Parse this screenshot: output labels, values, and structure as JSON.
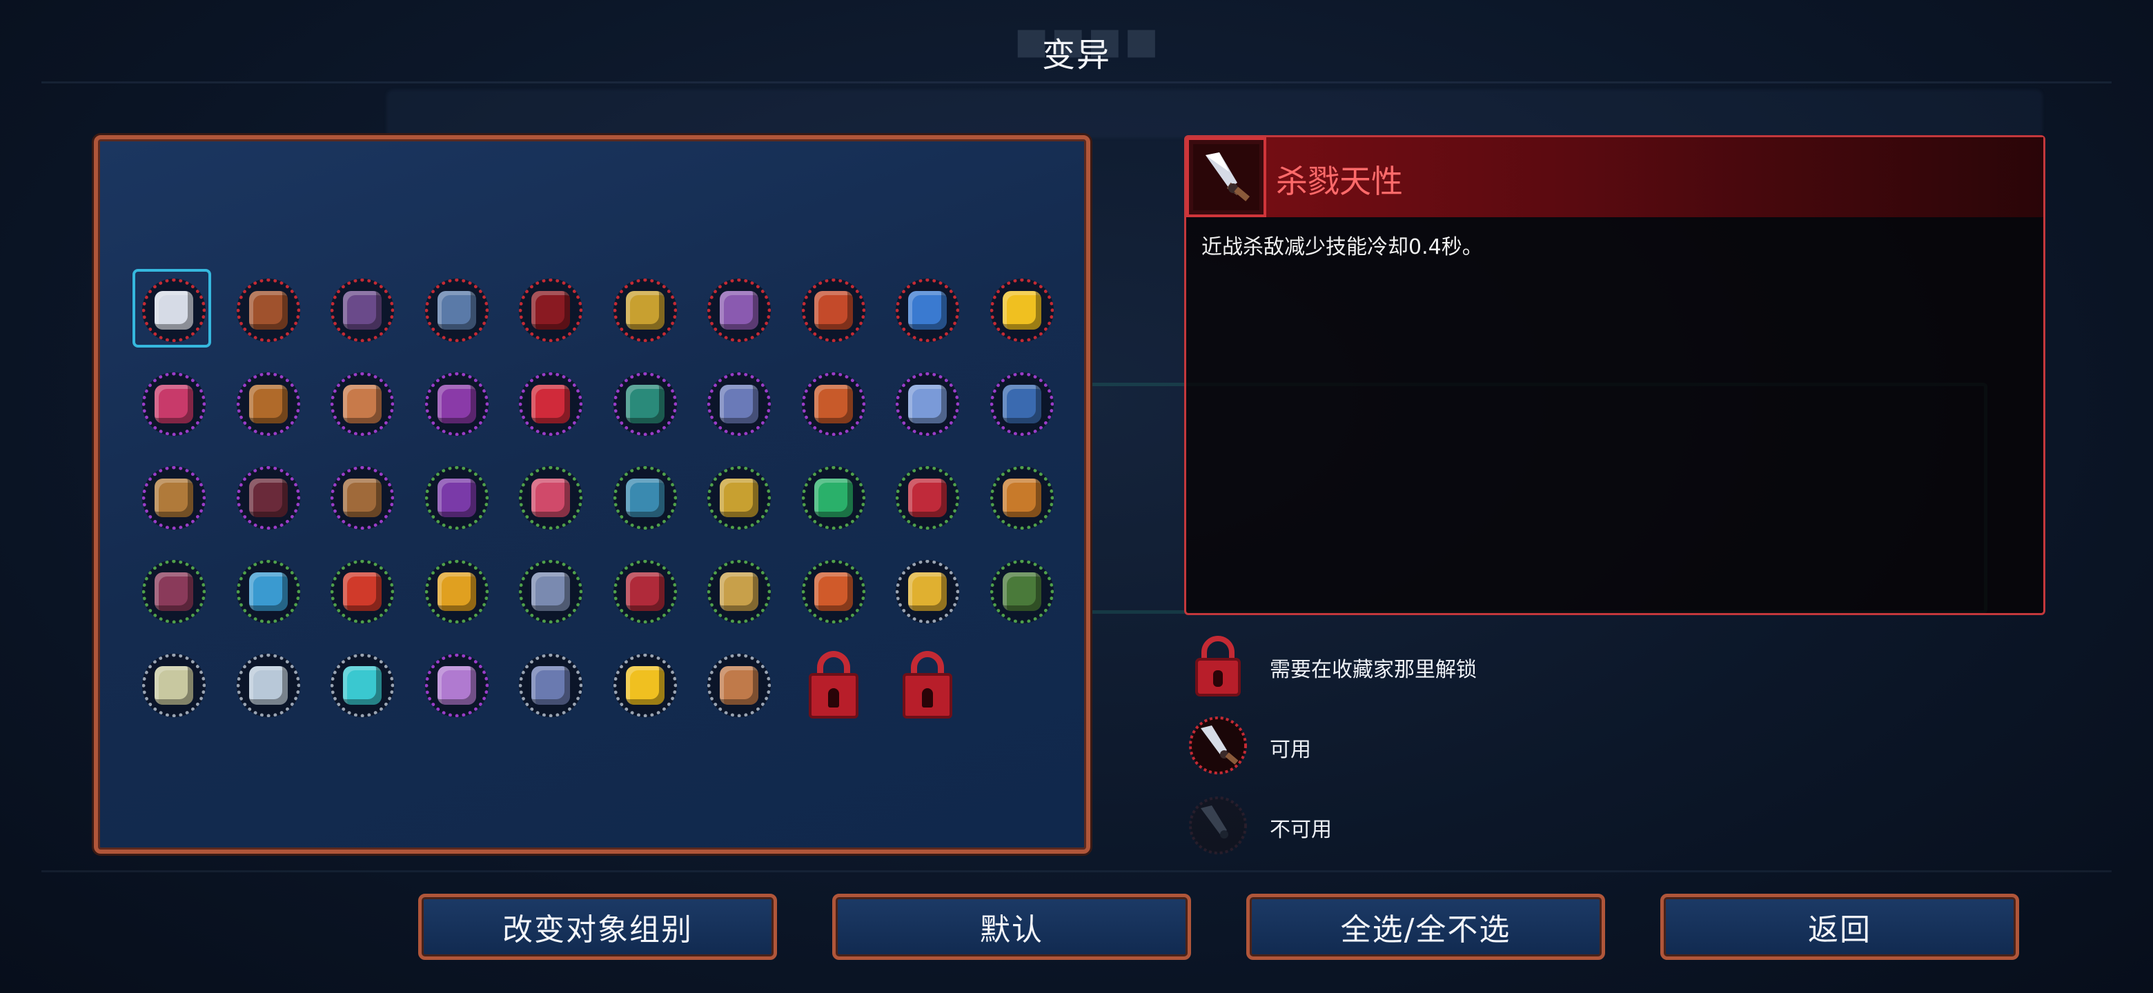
{
  "header": {
    "title": "变异"
  },
  "info": {
    "name": "杀戮天性",
    "description": "近战杀敌减少技能冷却0.4秒。",
    "icon": "dagger-icon"
  },
  "legend": [
    {
      "text": "需要在收藏家那里解锁",
      "icon": "lock-icon"
    },
    {
      "text": "可用",
      "icon": "dagger-icon"
    },
    {
      "text": "不可用",
      "icon": "dagger-disabled-icon"
    }
  ],
  "buttons": {
    "change_group": "改变对象组别",
    "default": "默认",
    "select_all": "全选/全不选",
    "back": "返回"
  },
  "colors": {
    "brutality": "#c42a34",
    "tactics": "#9a3cc8",
    "survival": "#4fa04a",
    "colorless": "#9aa4b2",
    "selection": "#36b8de"
  },
  "mutations": [
    {
      "icon": "dagger-icon",
      "color": "#c42a34",
      "fill": "#d6dbe6",
      "selected": true
    },
    {
      "icon": "bow-icon",
      "color": "#c42a34",
      "fill": "#a0522d"
    },
    {
      "icon": "claw-icon",
      "color": "#c42a34",
      "fill": "#6a4a8a"
    },
    {
      "icon": "scythe-frost-icon",
      "color": "#c42a34",
      "fill": "#5a7aa8"
    },
    {
      "icon": "slash-icon",
      "color": "#c42a34",
      "fill": "#8a1a22"
    },
    {
      "icon": "potion-icon",
      "color": "#c42a34",
      "fill": "#c8a030"
    },
    {
      "icon": "blaster-icon",
      "color": "#c42a34",
      "fill": "#8a5ab0"
    },
    {
      "icon": "apple-icon",
      "color": "#c42a34",
      "fill": "#c44a2a"
    },
    {
      "icon": "ice-potion-icon",
      "color": "#c42a34",
      "fill": "#3a7ad0"
    },
    {
      "icon": "lightning-icon",
      "color": "#c42a34",
      "fill": "#f0c020"
    },
    {
      "icon": "crystal-icon",
      "color": "#9a3cc8",
      "fill": "#c83a6a"
    },
    {
      "icon": "fist-icon",
      "color": "#9a3cc8",
      "fill": "#b06a2a"
    },
    {
      "icon": "ring-icon",
      "color": "#9a3cc8",
      "fill": "#c87a4a"
    },
    {
      "icon": "bomb-icon",
      "color": "#9a3cc8",
      "fill": "#8a3aa8"
    },
    {
      "icon": "cross-icon",
      "color": "#9a3cc8",
      "fill": "#d02a3a"
    },
    {
      "icon": "flask-icon",
      "color": "#9a3cc8",
      "fill": "#2a8a7a"
    },
    {
      "icon": "turret-icon",
      "color": "#9a3cc8",
      "fill": "#6a7ab8"
    },
    {
      "icon": "no-entry-icon",
      "color": "#9a3cc8",
      "fill": "#c85a2a"
    },
    {
      "icon": "whip-icon",
      "color": "#9a3cc8",
      "fill": "#7a9ad8"
    },
    {
      "icon": "shard-icon",
      "color": "#9a3cc8",
      "fill": "#3a6ab0"
    },
    {
      "icon": "crossbow-frost-icon",
      "color": "#9a3cc8",
      "fill": "#b07a3a"
    },
    {
      "icon": "bow-dark-icon",
      "color": "#9a3cc8",
      "fill": "#6a2a3a"
    },
    {
      "icon": "gauntlet-icon",
      "color": "#9a3cc8",
      "fill": "#a06a3a"
    },
    {
      "icon": "drop-icon",
      "color": "#4fa04a",
      "fill": "#7a3aa8"
    },
    {
      "icon": "skull-swords-icon",
      "color": "#4fa04a",
      "fill": "#d04a6a"
    },
    {
      "icon": "shield-eye-icon",
      "color": "#4fa04a",
      "fill": "#3a8ab0"
    },
    {
      "icon": "shield-icon",
      "color": "#4fa04a",
      "fill": "#c8a030"
    },
    {
      "icon": "heart-shield-icon",
      "color": "#4fa04a",
      "fill": "#2ab06a"
    },
    {
      "icon": "fang-icon",
      "color": "#4fa04a",
      "fill": "#c02a3a"
    },
    {
      "icon": "torch-icon",
      "color": "#4fa04a",
      "fill": "#c87a2a"
    },
    {
      "icon": "horseshoe-icon",
      "color": "#4fa04a",
      "fill": "#8a3a5a"
    },
    {
      "icon": "grid-icon",
      "color": "#4fa04a",
      "fill": "#3a9ad0"
    },
    {
      "icon": "flame-icon",
      "color": "#4fa04a",
      "fill": "#d03a2a"
    },
    {
      "icon": "double-chevron-icon",
      "color": "#4fa04a",
      "fill": "#e0a020"
    },
    {
      "icon": "fist-shield-icon",
      "color": "#4fa04a",
      "fill": "#7a8ab0"
    },
    {
      "icon": "heart-icon",
      "color": "#4fa04a",
      "fill": "#b02a3a"
    },
    {
      "icon": "horn-icon",
      "color": "#4fa04a",
      "fill": "#c8a04a"
    },
    {
      "icon": "potion-heal-icon",
      "color": "#4fa04a",
      "fill": "#d05a2a"
    },
    {
      "icon": "chevron-right-icon",
      "color": "#9aa4b2",
      "fill": "#e0b030"
    },
    {
      "icon": "leaf-icon",
      "color": "#4fa04a",
      "fill": "#4a7a3a"
    },
    {
      "icon": "skull-green-icon",
      "color": "#9aa4b2",
      "fill": "#c8c8a0"
    },
    {
      "icon": "skull-icon",
      "color": "#9aa4b2",
      "fill": "#b8c8d8"
    },
    {
      "icon": "pillar-icon",
      "color": "#9aa4b2",
      "fill": "#3ac8d0"
    },
    {
      "icon": "orb-icon",
      "color": "#9a3cc8",
      "fill": "#b07ad0"
    },
    {
      "icon": "hammer-icon",
      "color": "#9aa4b2",
      "fill": "#6a7ab0"
    },
    {
      "icon": "sun-icon",
      "color": "#9aa4b2",
      "fill": "#f0c020"
    },
    {
      "icon": "scroll-icon",
      "color": "#9aa4b2",
      "fill": "#c07a4a"
    },
    {
      "icon": "lock-icon",
      "locked": true
    },
    {
      "icon": "lock-icon",
      "locked": true
    }
  ]
}
